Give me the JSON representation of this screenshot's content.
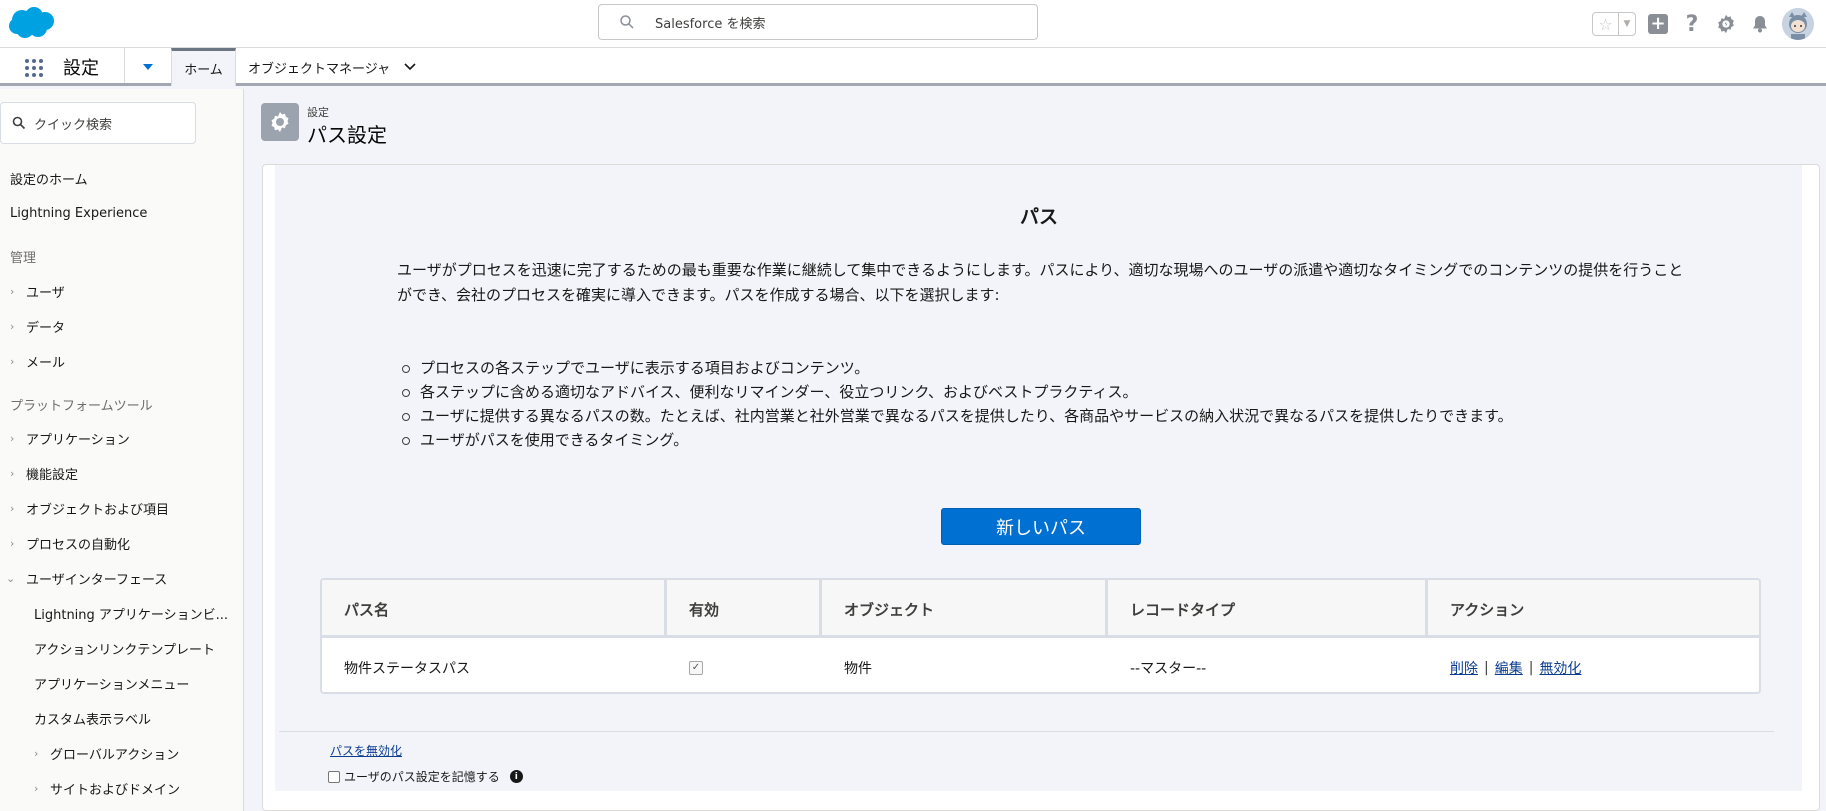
{
  "header": {
    "search_placeholder": "Salesforce を検索",
    "icons": [
      "favorites-star-icon",
      "favorites-dropdown-icon",
      "global-actions-plus-icon",
      "help-icon",
      "setup-gear-icon",
      "notifications-bell-icon",
      "user-avatar"
    ]
  },
  "nav": {
    "app_name": "設定",
    "tabs": [
      {
        "label": "ホーム",
        "active": true
      },
      {
        "label": "オブジェクトマネージャ",
        "active": false
      }
    ]
  },
  "sidebar": {
    "quick_find_placeholder": "クイック検索",
    "top_items": [
      "設定のホーム",
      "Lightning Experience"
    ],
    "admin_heading": "管理",
    "admin_items": [
      "ユーザ",
      "データ",
      "メール"
    ],
    "platform_heading": "プラットフォームツール",
    "platform_items": [
      "アプリケーション",
      "機能設定",
      "オブジェクトおよび項目",
      "プロセスの自動化",
      "ユーザインターフェース"
    ],
    "ui_children": [
      "Lightning アプリケーションビ...",
      "アクションリンクテンプレート",
      "アプリケーションメニュー",
      "カスタム表示ラベル",
      "グローバルアクション",
      "サイトおよびドメイン"
    ]
  },
  "page": {
    "breadcrumb": "設定",
    "title": "パス設定"
  },
  "content": {
    "section_title": "パス",
    "description": "ユーザがプロセスを迅速に完了するための最も重要な作業に継続して集中できるようにします。パスにより、適切な現場へのユーザの派遣や適切なタイミングでのコンテンツの提供を行うことができ、会社のプロセスを確実に導入できます。パスを作成する場合、以下を選択します:",
    "bullets": [
      "プロセスの各ステップでユーザに表示する項目およびコンテンツ。",
      "各ステップに含める適切なアドバイス、便利なリマインダー、役立つリンク、およびベストプラクティス。",
      "ユーザに提供する異なるパスの数。たとえば、社内営業と社外営業で異なるパスを提供したり、各商品やサービスの納入状況で異なるパスを提供したりできます。",
      "ユーザがパスを使用できるタイミング。"
    ],
    "new_path_button": "新しいパス"
  },
  "table": {
    "headers": [
      "パス名",
      "有効",
      "オブジェクト",
      "レコードタイプ",
      "アクション"
    ],
    "rows": [
      {
        "name": "物件ステータスパス",
        "active": true,
        "object": "物件",
        "record_type": "--マスター--",
        "actions": [
          "削除",
          "編集",
          "無効化"
        ]
      }
    ]
  },
  "footer": {
    "disable_link": "パスを無効化",
    "remember_label": "ユーザのパス設定を記憶する",
    "remember_checked": false
  },
  "colors": {
    "brand_blue": "#0070d2",
    "salesforce_cloud": "#00a1e0",
    "link": "#0b3d91"
  }
}
